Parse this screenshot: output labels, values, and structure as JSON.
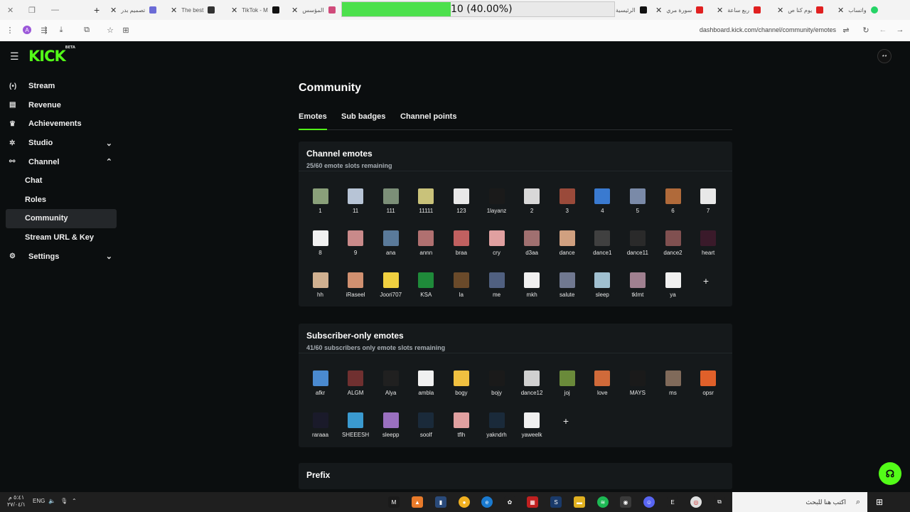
{
  "browser": {
    "tabs": [
      {
        "title": "تصميم بدر",
        "color": "#6b6bd6"
      },
      {
        "title": "The best",
        "color": "#333333"
      },
      {
        "title": "TikTok - M",
        "color": "#111111"
      },
      {
        "title": "المؤسس",
        "color": "#d04a7a"
      },
      {
        "title": "الرئيسية",
        "color": "#111111"
      },
      {
        "title": "سورة مري",
        "color": "#e02020"
      },
      {
        "title": "ربع ساعة",
        "color": "#e02020"
      },
      {
        "title": "يوم كنا ص",
        "color": "#e02020"
      },
      {
        "title": "واتساب",
        "color": "#25d366"
      }
    ],
    "progress": {
      "label": "10 (40.00%)",
      "fraction": 0.4
    },
    "url": "dashboard.kick.com/channel/community/emotes",
    "profile_initial": "A"
  },
  "app": {
    "logo": "KICK",
    "logo_badge": "BETA",
    "sidebar": {
      "items": [
        {
          "label": "Stream",
          "icon": "broadcast-icon",
          "glyph": "(•)"
        },
        {
          "label": "Revenue",
          "icon": "revenue-icon",
          "glyph": "▤"
        },
        {
          "label": "Achievements",
          "icon": "trophy-icon",
          "glyph": "♛"
        },
        {
          "label": "Studio",
          "icon": "studio-icon",
          "glyph": "✲"
        },
        {
          "label": "Channel",
          "icon": "channel-icon",
          "glyph": "⚯"
        },
        {
          "label": "Chat"
        },
        {
          "label": "Roles"
        },
        {
          "label": "Community"
        },
        {
          "label": "Stream URL & Key"
        },
        {
          "label": "Settings",
          "icon": "settings-icon",
          "glyph": "⚙"
        }
      ]
    },
    "page_title": "Community",
    "tabs": [
      "Emotes",
      "Sub badges",
      "Channel points"
    ],
    "channel_emotes": {
      "title": "Channel emotes",
      "subtitle": "25/60 emote slots remaining",
      "emotes": [
        "1",
        "11",
        "111",
        "11111",
        "123",
        "1layanz",
        "2",
        "3",
        "4",
        "5",
        "6",
        "7",
        "8",
        "9",
        "ana",
        "annn",
        "braa",
        "cry",
        "d3aa",
        "dance",
        "dance1",
        "dance11",
        "dance2",
        "heart",
        "hh",
        "iRaseel",
        "Joori707",
        "KSA",
        "la",
        "me",
        "mkh",
        "salute",
        "sleep",
        "tklmt",
        "ya"
      ],
      "colors": [
        "#8aa07a",
        "#b7c4d6",
        "#7c8f78",
        "#c9c27a",
        "#e8e8e8",
        "#1a1a1a",
        "#d8d8d8",
        "#9a4a3a",
        "#3a7ad0",
        "#7a8aa8",
        "#b06a3a",
        "#e8e8e8",
        "#f0f0f0",
        "#c98a8a",
        "#5a7a9a",
        "#b07070",
        "#c06060",
        "#e0a0a0",
        "#a07070",
        "#d0a080",
        "#404040",
        "#2a2a2a",
        "#805050",
        "#3a1a2a",
        "#d0b090",
        "#d09070",
        "#f0d040",
        "#1f8a3a",
        "#6a4a2a",
        "#506080",
        "#f0f0f0",
        "#707890",
        "#a0c0d0",
        "#a08090",
        "#f0f0f0"
      ]
    },
    "subscriber_emotes": {
      "title": "Subscriber-only emotes",
      "subtitle": "41/60 subscribers only emote slots remaining",
      "emotes": [
        "afkr",
        "ALGM",
        "Alya",
        "ambla",
        "bogy",
        "bojy",
        "dance12",
        "joj",
        "love",
        "MAYS",
        "ms",
        "opsr",
        "raraaa",
        "SHEEESH",
        "sleepp",
        "soolf",
        "tflh",
        "yakndrh",
        "yaweelk"
      ],
      "colors": [
        "#4a8ad0",
        "#703030",
        "#202020",
        "#f0f0f0",
        "#f0c040",
        "#1a1a1a",
        "#d0d0d0",
        "#6a8a3a",
        "#d06a3a",
        "#1a1a1a",
        "#806a5a",
        "#e0602a",
        "#1a1a2a",
        "#3a9ad0",
        "#9a70c0",
        "#1a2a3a",
        "#e0a0a0",
        "#1a2a3a",
        "#f0f0f0"
      ]
    },
    "prefix_title": "Prefix",
    "add_label": "+"
  },
  "taskbar": {
    "search_placeholder": "اكتب هنا للبحث",
    "language": "ENG",
    "time": "٥:٤١ م",
    "date": "٢٧/٠٤/١"
  }
}
